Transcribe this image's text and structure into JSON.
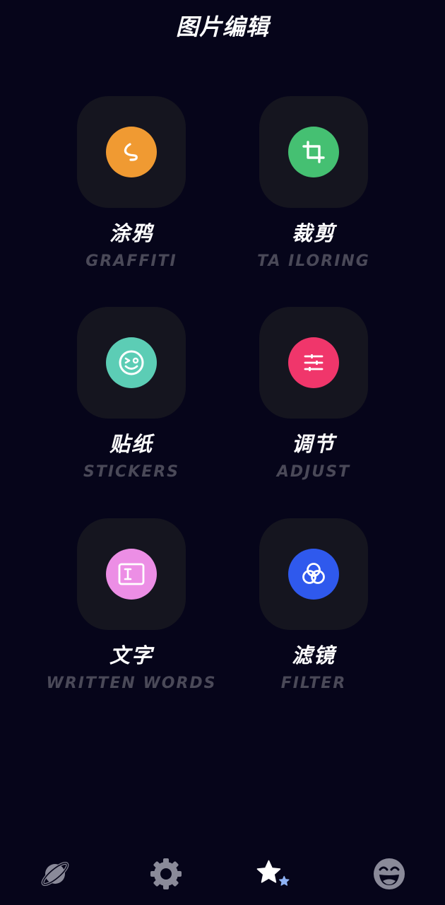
{
  "header": {
    "title": "图片编辑"
  },
  "tools": [
    {
      "title": "涂鸦",
      "subtitle": "GRAFFITI",
      "icon": "squiggle-icon",
      "color": "#f09a32"
    },
    {
      "title": "裁剪",
      "subtitle": "TA ILORING",
      "icon": "crop-icon",
      "color": "#45c072"
    },
    {
      "title": "贴纸",
      "subtitle": "STICKERS",
      "icon": "smiley-icon",
      "color": "#5ccdb5"
    },
    {
      "title": "调节",
      "subtitle": "ADJUST",
      "icon": "sliders-icon",
      "color": "#f0366b"
    },
    {
      "title": "文字",
      "subtitle": "WRITTEN WORDS",
      "icon": "text-box-icon",
      "color": "#ec8ee5"
    },
    {
      "title": "滤镜",
      "subtitle": "FILTER",
      "icon": "filter-circles-icon",
      "color": "#2f59ed"
    }
  ],
  "tabbar": {
    "tabs": [
      {
        "icon": "planet-icon",
        "color": "#8a8a99",
        "active": false
      },
      {
        "icon": "gear-icon",
        "color": "#8a8a99",
        "active": false
      },
      {
        "icon": "stars-icon",
        "color": "#ffffff",
        "accent": "#8fb3f5",
        "active": true
      },
      {
        "icon": "laughing-face-icon",
        "color": "#8a8a99",
        "active": false
      }
    ]
  }
}
